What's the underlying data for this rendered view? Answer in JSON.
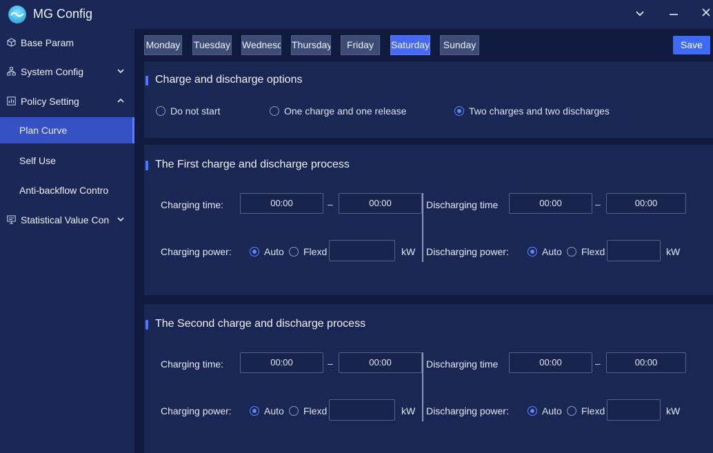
{
  "app": {
    "title": "MG Config"
  },
  "sidebar": {
    "items": [
      {
        "label": "Base Param"
      },
      {
        "label": "System Config"
      },
      {
        "label": "Policy Setting"
      },
      {
        "label": "Plan Curve"
      },
      {
        "label": "Self Use"
      },
      {
        "label": "Anti-backflow Contro"
      },
      {
        "label": "Statistical Value Con"
      }
    ]
  },
  "days": {
    "tabs": [
      "Monday",
      "Tuesday",
      "Wednesda",
      "Thursday",
      "Friday",
      "Saturday",
      "Sunday"
    ],
    "selected": "Saturday"
  },
  "toolbar": {
    "save_label": "Save"
  },
  "options": {
    "title": "Charge and discharge options",
    "choices": [
      "Do not start",
      "One charge and one release",
      "Two charges and two discharges"
    ],
    "selected": "Two charges and two discharges"
  },
  "processes": [
    {
      "title": "The First charge and discharge process",
      "charging_time_label": "Charging time:",
      "charge_start": "00:00",
      "charge_end": "00:00",
      "discharging_time_label": "Discharging time",
      "discharge_start": "00:00",
      "discharge_end": "00:00",
      "charging_power_label": "Charging power:",
      "discharging_power_label": "Discharging power:",
      "auto_label": "Auto",
      "fixed_label": "Flexd",
      "unit": "kW"
    },
    {
      "title": "The Second charge and discharge process",
      "charging_time_label": "Charging time:",
      "charge_start": "00:00",
      "charge_end": "00:00",
      "discharging_time_label": "Discharging time",
      "discharge_start": "00:00",
      "discharge_end": "00:00",
      "charging_power_label": "Charging power:",
      "discharging_power_label": "Discharging power:",
      "auto_label": "Auto",
      "fixed_label": "Flexd",
      "unit": "kW"
    }
  ],
  "colors": {
    "accent": "#4768f0",
    "sidebar_active": "#3551c4",
    "background": "#101a3f"
  }
}
